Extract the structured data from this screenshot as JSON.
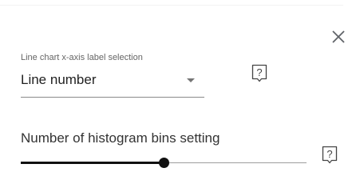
{
  "dialog": {
    "close_icon": "close-icon"
  },
  "line_chart_x_axis": {
    "caption": "Line chart x-axis label selection",
    "selected_value": "Line number",
    "dropdown_icon": "chevron-down-icon",
    "help_icon": "help-icon"
  },
  "histogram_bins": {
    "label": "Number of histogram bins setting",
    "level_fraction": 0.5,
    "help_icon": "help-icon"
  },
  "colors": {
    "slider_active": "#111111",
    "slider_inactive": "#9e9e9e",
    "underline": "#8a8a8a"
  }
}
